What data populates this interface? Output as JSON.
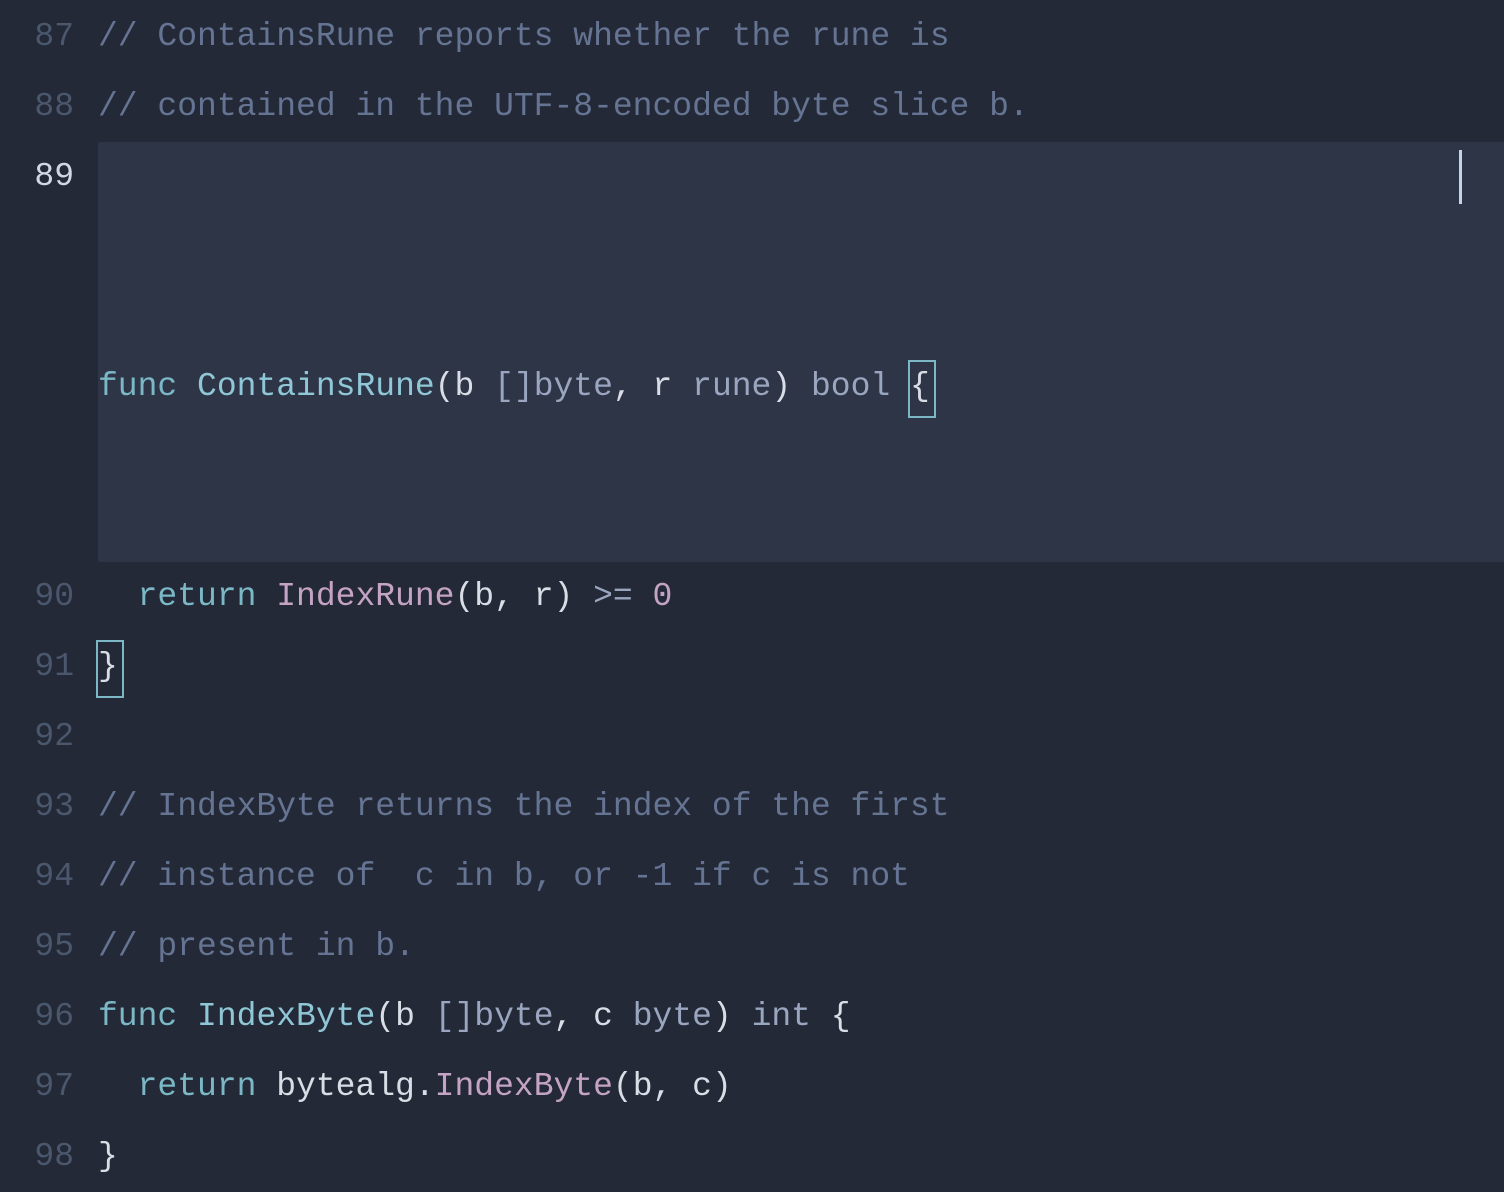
{
  "editor": {
    "lineNumbers": {
      "l87": "87",
      "l88": "88",
      "l89": "89",
      "l90": "90",
      "l91": "91",
      "l92": "92",
      "l93": "93",
      "l94": "94",
      "l95": "95",
      "l96": "96",
      "l97": "97",
      "l98": "98"
    },
    "activeLine": 89,
    "l87": {
      "comment": "// ContainsRune reports whether the rune is"
    },
    "l88": {
      "comment": "// contained in the UTF-8-encoded byte slice b."
    },
    "l89": {
      "kw_func": "func ",
      "name": "ContainsRune",
      "lparen": "(",
      "p1": "b ",
      "p1type": "[]byte",
      "comma": ", ",
      "p2": "r ",
      "p2type": "rune",
      "rparen": ") ",
      "ret": "bool ",
      "lbrace": "{"
    },
    "l90": {
      "indent": "  ",
      "kw_return": "return ",
      "call": "IndexRune",
      "lparen": "(",
      "a1": "b",
      "comma": ", ",
      "a2": "r",
      "rparen": ") ",
      "op": ">= ",
      "num": "0"
    },
    "l91": {
      "rbrace": "}"
    },
    "l92": {
      "blank": ""
    },
    "l93": {
      "comment": "// IndexByte returns the index of the first"
    },
    "l94": {
      "comment": "// instance of  c in b, or -1 if c is not"
    },
    "l95": {
      "comment": "// present in b."
    },
    "l96": {
      "kw_func": "func ",
      "name": "IndexByte",
      "lparen": "(",
      "p1": "b ",
      "p1type": "[]byte",
      "comma": ", ",
      "p2": "c ",
      "p2type": "byte",
      "rparen": ") ",
      "ret": "int ",
      "lbrace": "{"
    },
    "l97": {
      "indent": "  ",
      "kw_return": "return ",
      "pkg": "bytealg",
      "dot": ".",
      "call": "IndexByte",
      "lparen": "(",
      "a1": "b",
      "comma": ", ",
      "a2": "c",
      "rparen": ")"
    },
    "l98": {
      "rbrace": "}"
    }
  }
}
